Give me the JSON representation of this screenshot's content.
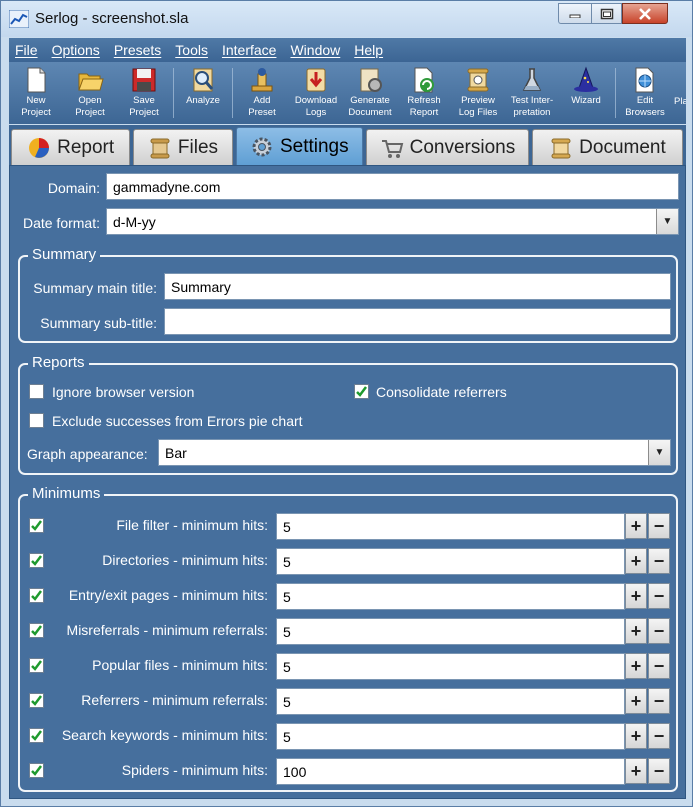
{
  "window": {
    "title": "Serlog - screenshot.sla"
  },
  "menu": [
    {
      "label": "File"
    },
    {
      "label": "Options"
    },
    {
      "label": "Presets"
    },
    {
      "label": "Tools"
    },
    {
      "label": "Interface"
    },
    {
      "label": "Window"
    },
    {
      "label": "Help"
    }
  ],
  "toolbar": [
    {
      "label": "New\nProject",
      "icon": "new-project-icon"
    },
    {
      "label": "Open\nProject",
      "icon": "open-project-icon"
    },
    {
      "label": "Save\nProject",
      "icon": "save-project-icon"
    },
    {
      "label": "Analyze",
      "icon": "analyze-icon"
    },
    {
      "label": "Add\nPreset",
      "icon": "add-preset-icon"
    },
    {
      "label": "Download\nLogs",
      "icon": "download-logs-icon"
    },
    {
      "label": "Generate\nDocument",
      "icon": "generate-document-icon"
    },
    {
      "label": "Refresh\nReport",
      "icon": "refresh-report-icon"
    },
    {
      "label": "Preview\nLog Files",
      "icon": "preview-log-files-icon"
    },
    {
      "label": "Test Inter-\npretation",
      "icon": "test-interpretation-icon"
    },
    {
      "label": "Wizard",
      "icon": "wizard-icon"
    },
    {
      "label": "Edit\nBrowsers",
      "icon": "edit-browsers-icon"
    },
    {
      "label": "Pla",
      "icon": "partial-icon"
    }
  ],
  "tabs": [
    {
      "label": "Report"
    },
    {
      "label": "Files"
    },
    {
      "label": "Settings"
    },
    {
      "label": "Conversions"
    },
    {
      "label": "Document"
    }
  ],
  "settings": {
    "domain_label": "Domain:",
    "domain_value": "gammadyne.com",
    "date_format_label": "Date format:",
    "date_format_value": "d-M-yy"
  },
  "summary": {
    "title": "Summary",
    "main_title_label": "Summary main title:",
    "main_title_value": "Summary",
    "sub_title_label": "Summary sub-title:",
    "sub_title_value": ""
  },
  "reports": {
    "title": "Reports",
    "ignore_browser_version": {
      "label": "Ignore browser version",
      "checked": false
    },
    "consolidate_referrers": {
      "label": "Consolidate referrers",
      "checked": true
    },
    "exclude_successes": {
      "label": "Exclude successes from Errors pie chart",
      "checked": false
    },
    "graph_appearance_label": "Graph appearance:",
    "graph_appearance_value": "Bar"
  },
  "minimums": {
    "title": "Minimums",
    "rows": [
      {
        "label": "File filter - minimum hits:",
        "value": "5",
        "checked": true
      },
      {
        "label": "Directories - minimum hits:",
        "value": "5",
        "checked": true
      },
      {
        "label": "Entry/exit pages - minimum hits:",
        "value": "5",
        "checked": true
      },
      {
        "label": "Misreferrals - minimum referrals:",
        "value": "5",
        "checked": true
      },
      {
        "label": "Popular files - minimum hits:",
        "value": "5",
        "checked": true
      },
      {
        "label": "Referrers - minimum referrals:",
        "value": "5",
        "checked": true
      },
      {
        "label": "Search keywords - minimum hits:",
        "value": "5",
        "checked": true
      },
      {
        "label": "Spiders - minimum hits:",
        "value": "100",
        "checked": true
      }
    ],
    "plus": "+",
    "minus": "−"
  },
  "colors": {
    "panel": "#466f9d",
    "check": "#1f9a2e",
    "active_tab": "#6fa9da"
  }
}
